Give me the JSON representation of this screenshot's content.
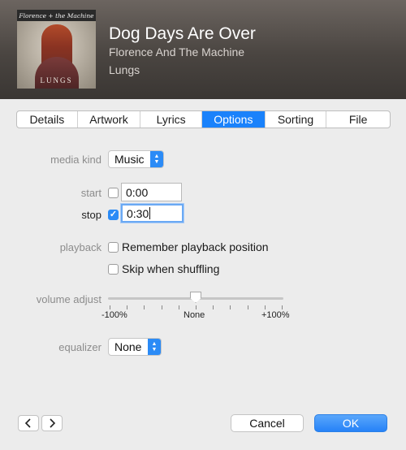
{
  "header": {
    "title": "Dog Days Are Over",
    "artist": "Florence And The Machine",
    "album": "Lungs",
    "artwork": {
      "band_text": "Florence + the Machine",
      "album_text": "LUNGS"
    }
  },
  "tabs": [
    {
      "label": "Details",
      "active": false
    },
    {
      "label": "Artwork",
      "active": false
    },
    {
      "label": "Lyrics",
      "active": false
    },
    {
      "label": "Options",
      "active": true
    },
    {
      "label": "Sorting",
      "active": false
    },
    {
      "label": "File",
      "active": false
    }
  ],
  "options": {
    "media_kind": {
      "label": "media kind",
      "value": "Music"
    },
    "start": {
      "label": "start",
      "checked": false,
      "value": "0:00"
    },
    "stop": {
      "label": "stop",
      "checked": true,
      "value": "0:30"
    },
    "playback": {
      "label": "playback",
      "remember_label": "Remember playback position",
      "skip_label": "Skip when shuffling"
    },
    "volume_adjust": {
      "label": "volume adjust",
      "min_label": "-100%",
      "mid_label": "None",
      "max_label": "+100%",
      "value_percent": 0
    },
    "equalizer": {
      "label": "equalizer",
      "value": "None"
    }
  },
  "footer": {
    "prev_icon": "chevron-left-icon",
    "next_icon": "chevron-right-icon",
    "cancel_label": "Cancel",
    "ok_label": "OK"
  },
  "colors": {
    "accent": "#1a82fb",
    "header": "#4a4541"
  }
}
